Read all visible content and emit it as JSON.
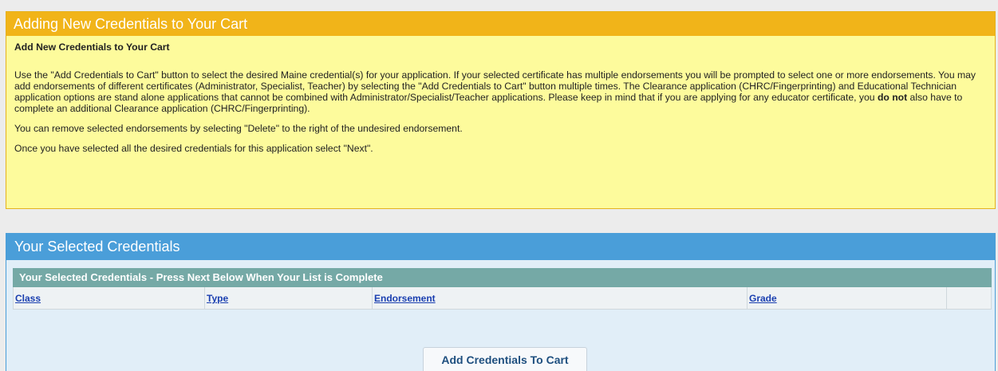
{
  "info_panel": {
    "title": "Adding New Credentials to Your Cart",
    "subtitle": "Add New Credentials to Your Cart",
    "paragraph1_part1": "Use the \"Add Credentials to Cart\" button to select the desired Maine credential(s) for your application.  If your selected certificate has multiple endorsements you will be prompted to select one or more endorsements.  You may add endorsements of different certificates (Administrator, Specialist, Teacher)  by selecting the \"Add Credentials to Cart\" button multiple times.  The Clearance application (CHRC/Fingerprinting) and Educational Technician application options are stand alone applications that cannot be combined with Administrator/Specialist/Teacher applications.  Please keep in mind that if you are applying for any educator certificate, you ",
    "paragraph1_bold": "do not",
    "paragraph1_part2": " also have to complete an additional Clearance application (CHRC/Fingerprinting).",
    "paragraph2": "You can remove selected endorsements by selecting \"Delete\" to the right of the undesired endorsement.",
    "paragraph3": "Once you have selected all the desired credentials for this application select \"Next\"."
  },
  "selected_panel": {
    "title": "Your Selected Credentials",
    "table_caption": "Your Selected Credentials - Press Next Below When Your List is Complete",
    "columns": {
      "class": "Class",
      "type": "Type",
      "endorsement": "Endorsement",
      "grade": "Grade"
    },
    "add_button_label": "Add Credentials To Cart"
  },
  "colors": {
    "info_header": "#f1b419",
    "info_body": "#fdfb9c",
    "selected_header": "#4a9ed9",
    "table_caption": "#75a9a6",
    "link": "#1a3fb0"
  }
}
